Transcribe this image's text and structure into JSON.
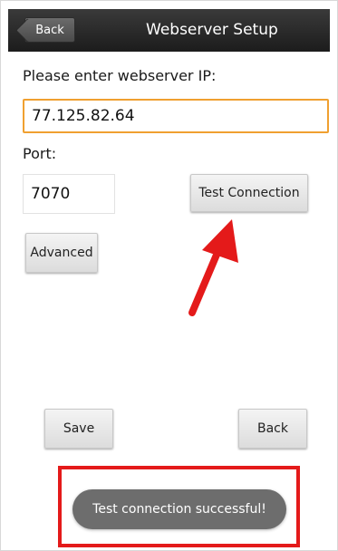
{
  "header": {
    "back_label": "Back",
    "title": "Webserver Setup"
  },
  "form": {
    "ip_label": "Please enter webserver IP:",
    "ip_value": "77.125.82.64",
    "port_label": "Port:",
    "port_value": "7070",
    "test_connection_label": "Test Connection",
    "advanced_label": "Advanced"
  },
  "footer": {
    "save_label": "Save",
    "back_label": "Back"
  },
  "toast": {
    "message": "Test connection successful!"
  },
  "colors": {
    "titlebar": "#2a2a2a",
    "focused_field_border": "#f0a030",
    "annotation_red": "#e41a1a",
    "toast_bg": "#6d6d6d"
  },
  "icons": {
    "annotation_arrow": "red-arrow-icon"
  }
}
